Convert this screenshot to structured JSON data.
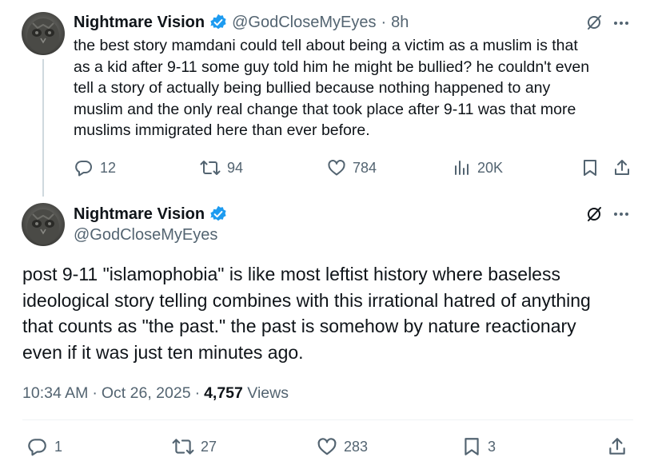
{
  "reply_tweet": {
    "author_name": "Nightmare Vision",
    "handle": "@GodCloseMyEyes",
    "separator": "·",
    "time": "8h",
    "text_lines": [
      "the best story mamdani could tell about being a victim as a muslim is that",
      "as a kid after 9-11 some guy told him he might be bullied? he couldn't even",
      "tell a story of actually being bullied because nothing happened to any",
      "muslim and the only real change that took place after 9-11 was that more",
      "muslims immigrated here than ever before."
    ],
    "replies": "12",
    "reposts": "94",
    "likes": "784",
    "views": "20K"
  },
  "main_tweet": {
    "author_name": "Nightmare Vision",
    "handle": "@GodCloseMyEyes",
    "text_lines": [
      "post 9-11 \"islamophobia\" is like most leftist history where baseless",
      "ideological story telling combines with this irrational hatred of anything",
      "that counts as \"the past.\" the past is somehow by nature reactionary",
      "even if it was just ten minutes ago."
    ],
    "time": "10:34 AM",
    "separator": "·",
    "date": "Oct 26, 2025",
    "view_count": "4,757",
    "views_label": "Views",
    "replies": "1",
    "reposts": "27",
    "likes": "283",
    "bookmarks": "3"
  },
  "colors": {
    "text_primary": "#0f1419",
    "text_secondary": "#536471",
    "verified_blue": "#1d9bf0",
    "divider": "#eff3f4",
    "thread_line": "#cfd9de"
  },
  "icons": [
    "verified-badge-icon",
    "grok-icon",
    "more-icon",
    "reply-icon",
    "repost-icon",
    "like-icon",
    "views-icon",
    "bookmark-icon",
    "share-icon"
  ]
}
